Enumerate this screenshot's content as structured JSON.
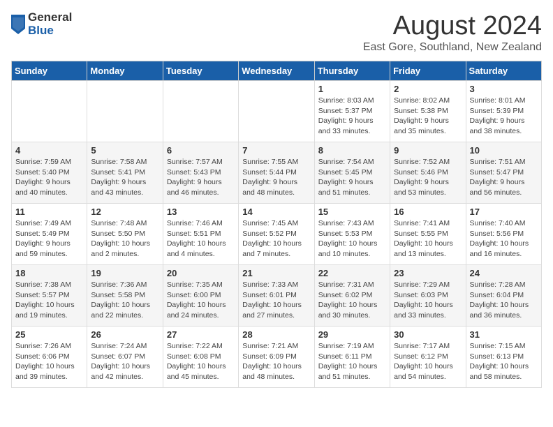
{
  "logo": {
    "general": "General",
    "blue": "Blue"
  },
  "header": {
    "month": "August 2024",
    "location": "East Gore, Southland, New Zealand"
  },
  "weekdays": [
    "Sunday",
    "Monday",
    "Tuesday",
    "Wednesday",
    "Thursday",
    "Friday",
    "Saturday"
  ],
  "weeks": [
    [
      {
        "day": "",
        "info": ""
      },
      {
        "day": "",
        "info": ""
      },
      {
        "day": "",
        "info": ""
      },
      {
        "day": "",
        "info": ""
      },
      {
        "day": "1",
        "info": "Sunrise: 8:03 AM\nSunset: 5:37 PM\nDaylight: 9 hours\nand 33 minutes."
      },
      {
        "day": "2",
        "info": "Sunrise: 8:02 AM\nSunset: 5:38 PM\nDaylight: 9 hours\nand 35 minutes."
      },
      {
        "day": "3",
        "info": "Sunrise: 8:01 AM\nSunset: 5:39 PM\nDaylight: 9 hours\nand 38 minutes."
      }
    ],
    [
      {
        "day": "4",
        "info": "Sunrise: 7:59 AM\nSunset: 5:40 PM\nDaylight: 9 hours\nand 40 minutes."
      },
      {
        "day": "5",
        "info": "Sunrise: 7:58 AM\nSunset: 5:41 PM\nDaylight: 9 hours\nand 43 minutes."
      },
      {
        "day": "6",
        "info": "Sunrise: 7:57 AM\nSunset: 5:43 PM\nDaylight: 9 hours\nand 46 minutes."
      },
      {
        "day": "7",
        "info": "Sunrise: 7:55 AM\nSunset: 5:44 PM\nDaylight: 9 hours\nand 48 minutes."
      },
      {
        "day": "8",
        "info": "Sunrise: 7:54 AM\nSunset: 5:45 PM\nDaylight: 9 hours\nand 51 minutes."
      },
      {
        "day": "9",
        "info": "Sunrise: 7:52 AM\nSunset: 5:46 PM\nDaylight: 9 hours\nand 53 minutes."
      },
      {
        "day": "10",
        "info": "Sunrise: 7:51 AM\nSunset: 5:47 PM\nDaylight: 9 hours\nand 56 minutes."
      }
    ],
    [
      {
        "day": "11",
        "info": "Sunrise: 7:49 AM\nSunset: 5:49 PM\nDaylight: 9 hours\nand 59 minutes."
      },
      {
        "day": "12",
        "info": "Sunrise: 7:48 AM\nSunset: 5:50 PM\nDaylight: 10 hours\nand 2 minutes."
      },
      {
        "day": "13",
        "info": "Sunrise: 7:46 AM\nSunset: 5:51 PM\nDaylight: 10 hours\nand 4 minutes."
      },
      {
        "day": "14",
        "info": "Sunrise: 7:45 AM\nSunset: 5:52 PM\nDaylight: 10 hours\nand 7 minutes."
      },
      {
        "day": "15",
        "info": "Sunrise: 7:43 AM\nSunset: 5:53 PM\nDaylight: 10 hours\nand 10 minutes."
      },
      {
        "day": "16",
        "info": "Sunrise: 7:41 AM\nSunset: 5:55 PM\nDaylight: 10 hours\nand 13 minutes."
      },
      {
        "day": "17",
        "info": "Sunrise: 7:40 AM\nSunset: 5:56 PM\nDaylight: 10 hours\nand 16 minutes."
      }
    ],
    [
      {
        "day": "18",
        "info": "Sunrise: 7:38 AM\nSunset: 5:57 PM\nDaylight: 10 hours\nand 19 minutes."
      },
      {
        "day": "19",
        "info": "Sunrise: 7:36 AM\nSunset: 5:58 PM\nDaylight: 10 hours\nand 22 minutes."
      },
      {
        "day": "20",
        "info": "Sunrise: 7:35 AM\nSunset: 6:00 PM\nDaylight: 10 hours\nand 24 minutes."
      },
      {
        "day": "21",
        "info": "Sunrise: 7:33 AM\nSunset: 6:01 PM\nDaylight: 10 hours\nand 27 minutes."
      },
      {
        "day": "22",
        "info": "Sunrise: 7:31 AM\nSunset: 6:02 PM\nDaylight: 10 hours\nand 30 minutes."
      },
      {
        "day": "23",
        "info": "Sunrise: 7:29 AM\nSunset: 6:03 PM\nDaylight: 10 hours\nand 33 minutes."
      },
      {
        "day": "24",
        "info": "Sunrise: 7:28 AM\nSunset: 6:04 PM\nDaylight: 10 hours\nand 36 minutes."
      }
    ],
    [
      {
        "day": "25",
        "info": "Sunrise: 7:26 AM\nSunset: 6:06 PM\nDaylight: 10 hours\nand 39 minutes."
      },
      {
        "day": "26",
        "info": "Sunrise: 7:24 AM\nSunset: 6:07 PM\nDaylight: 10 hours\nand 42 minutes."
      },
      {
        "day": "27",
        "info": "Sunrise: 7:22 AM\nSunset: 6:08 PM\nDaylight: 10 hours\nand 45 minutes."
      },
      {
        "day": "28",
        "info": "Sunrise: 7:21 AM\nSunset: 6:09 PM\nDaylight: 10 hours\nand 48 minutes."
      },
      {
        "day": "29",
        "info": "Sunrise: 7:19 AM\nSunset: 6:11 PM\nDaylight: 10 hours\nand 51 minutes."
      },
      {
        "day": "30",
        "info": "Sunrise: 7:17 AM\nSunset: 6:12 PM\nDaylight: 10 hours\nand 54 minutes."
      },
      {
        "day": "31",
        "info": "Sunrise: 7:15 AM\nSunset: 6:13 PM\nDaylight: 10 hours\nand 58 minutes."
      }
    ]
  ]
}
